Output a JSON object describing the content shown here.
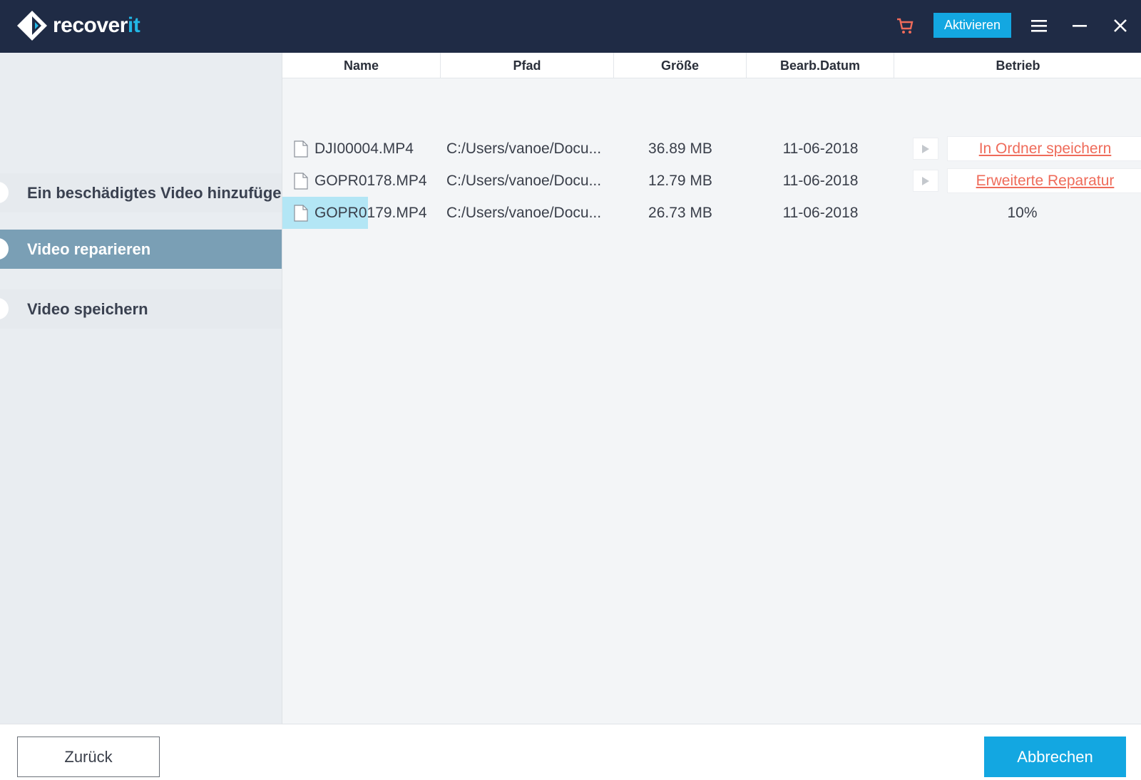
{
  "app": {
    "logo_text_main": "recover",
    "logo_text_accent": "it",
    "activate_label": "Aktivieren",
    "icons": [
      "logo-icon",
      "cart-icon",
      "menu-icon",
      "minimize-icon",
      "close-icon"
    ],
    "colors": {
      "titlebar": "#1f2b45",
      "accent": "#13a7e1",
      "link": "#ef6b5a",
      "active_step": "#7a9fb5"
    }
  },
  "sidebar": {
    "steps": [
      {
        "label": "Ein beschädigtes Video hinzufügen",
        "active": false
      },
      {
        "label": "Video reparieren",
        "active": true
      },
      {
        "label": "Video speichern",
        "active": false
      }
    ]
  },
  "table": {
    "headers": [
      "Name",
      "Pfad",
      "Größe",
      "Bearb.Datum",
      "Betrieb"
    ],
    "rows": [
      {
        "name": "DJI00004.MP4",
        "path": "C:/Users/vanoe/Docu...",
        "size": "36.89  MB",
        "date": "11-06-2018",
        "operation": "In Ordner speichern",
        "op_type": "link"
      },
      {
        "name": "GOPR0178.MP4",
        "path": "C:/Users/vanoe/Docu...",
        "size": "12.79  MB",
        "date": "11-06-2018",
        "operation": "Erweiterte Reparatur",
        "op_type": "link"
      },
      {
        "name": "GOPR0179.MP4",
        "path": "C:/Users/vanoe/Docu...",
        "size": "26.73  MB",
        "date": "11-06-2018",
        "operation": "10%",
        "op_type": "progress"
      }
    ]
  },
  "footer": {
    "back_label": "Zurück",
    "cancel_label": "Abbrechen"
  }
}
